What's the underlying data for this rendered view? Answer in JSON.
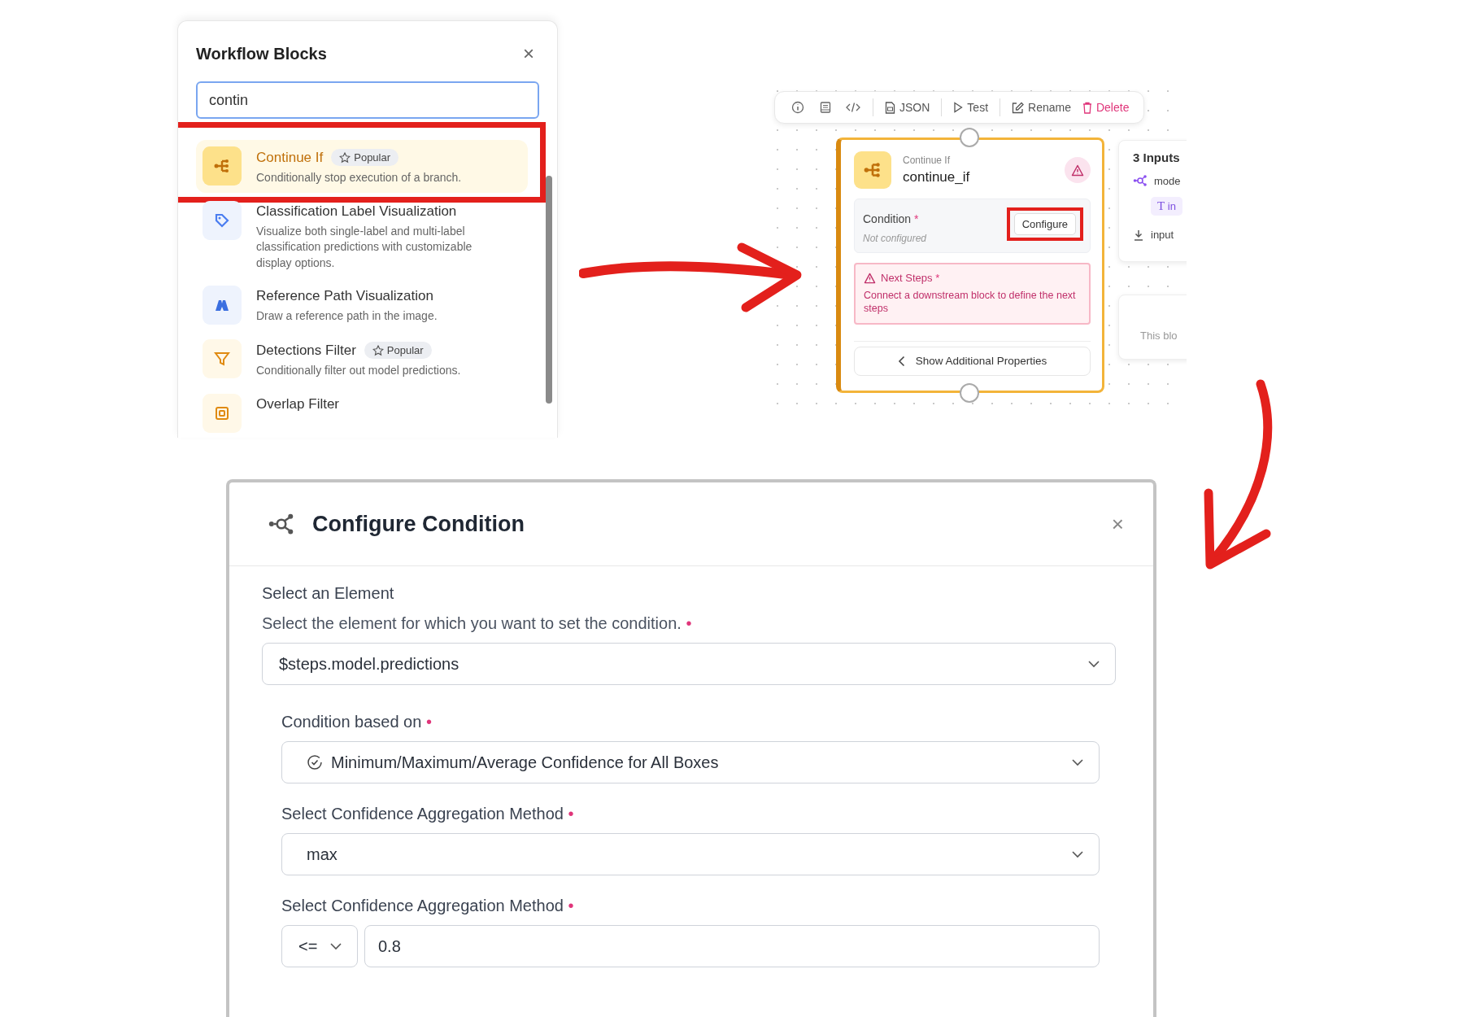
{
  "blocks_panel": {
    "title": "Workflow Blocks",
    "close": "×",
    "search": {
      "value": "contin"
    },
    "items": [
      {
        "name": "Continue If",
        "description": "Conditionally stop execution of a branch.",
        "popular": true,
        "popular_label": "Popular",
        "selected": true,
        "annotated": true
      },
      {
        "name": "Classification Label Visualization",
        "description": "Visualize both single-label and multi-label classification predictions with customizable display options.",
        "popular": false,
        "selected": false,
        "annotated": false
      },
      {
        "name": "Reference Path Visualization",
        "description": "Draw a reference path in the image.",
        "popular": false,
        "selected": false,
        "annotated": false
      },
      {
        "name": "Detections Filter",
        "description": "Conditionally filter out model predictions.",
        "popular": true,
        "popular_label": "Popular",
        "selected": false,
        "annotated": false
      },
      {
        "name": "Overlap Filter",
        "popular": false,
        "selected": false,
        "annotated": false
      }
    ]
  },
  "canvas": {
    "toolbar": [
      {
        "label": "JSON",
        "danger": false
      },
      {
        "label": "Test",
        "danger": false
      },
      {
        "label": "Rename",
        "danger": false
      },
      {
        "label": "Delete",
        "danger": true
      }
    ],
    "node": {
      "type": "Continue If",
      "name": "continue_if",
      "field": {
        "label": "Condition",
        "required_mark": "*",
        "value": "Not configured",
        "button": "Configure",
        "annotated": true
      },
      "alert": {
        "title": "Next Steps",
        "required_mark": "*",
        "message": "Connect a downstream block to define the next steps"
      },
      "more_button": "Show Additional Properties"
    },
    "side_card": {
      "title": "3 Inputs",
      "input_name": "mode",
      "type_symbol": "T",
      "type_badge": "in",
      "input_label": "input"
    },
    "side_note": "This blo"
  },
  "dialog": {
    "title": "Configure Condition",
    "close": "×",
    "section": "Select an Element",
    "description": "Select the element for which you want to set the condition.",
    "required_mark": "•",
    "element": "$steps.model.predictions",
    "fields": [
      {
        "kind": "select",
        "label": "Condition based on",
        "required_mark": "•",
        "value": "Minimum/Maximum/Average Confidence for All Boxes"
      },
      {
        "kind": "select",
        "label": "Select Confidence Aggregation Method",
        "required_mark": "•",
        "value": "max"
      },
      {
        "kind": "compare",
        "label": "Select Confidence Aggregation Method",
        "required_mark": "•",
        "operator": "<=",
        "value": "0.8"
      }
    ]
  }
}
